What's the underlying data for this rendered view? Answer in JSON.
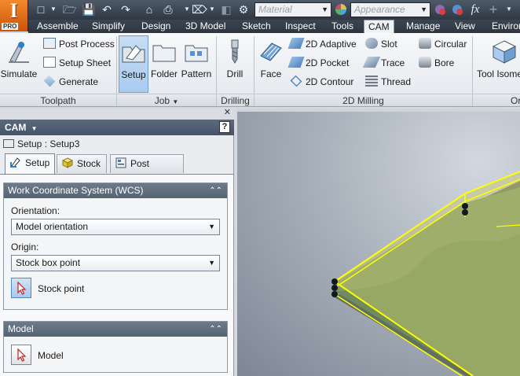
{
  "app": {
    "logo_letter": "I",
    "edition": "PRO"
  },
  "quick_access": {
    "material_placeholder": "Material",
    "appearance_placeholder": "Appearance",
    "fx_label": "fx"
  },
  "ribbon_tabs": [
    {
      "label": "Assemble"
    },
    {
      "label": "Simplify"
    },
    {
      "label": "Design"
    },
    {
      "label": "3D Model"
    },
    {
      "label": "Sketch"
    },
    {
      "label": "Inspect"
    },
    {
      "label": "Tools"
    },
    {
      "label": "CAM",
      "active": true
    },
    {
      "label": "Manage"
    },
    {
      "label": "View"
    },
    {
      "label": "Environ"
    }
  ],
  "ribbon": {
    "toolpath": {
      "label": "Toolpath",
      "simulate": "Simulate",
      "post_process": "Post Process",
      "setup_sheet": "Setup Sheet",
      "generate": "Generate"
    },
    "job": {
      "label": "Job",
      "setup": "Setup",
      "folder": "Folder",
      "pattern": "Pattern"
    },
    "drilling": {
      "label": "Drilling",
      "drill": "Drill"
    },
    "milling2d": {
      "label": "2D Milling",
      "face": "Face",
      "adaptive": "2D Adaptive",
      "pocket": "2D Pocket",
      "contour": "2D Contour",
      "slot": "Slot",
      "trace": "Trace",
      "thread": "Thread",
      "circular": "Circular",
      "bore": "Bore"
    },
    "next": {
      "tool_label": "Tool Isome",
      "group_label": "Or"
    }
  },
  "panel": {
    "title": "CAM",
    "breadcrumb": "Setup : Setup3",
    "tabs": [
      {
        "label": "Setup",
        "active": true
      },
      {
        "label": "Stock"
      },
      {
        "label": "Post Process"
      }
    ],
    "wcs": {
      "heading": "Work Coordinate System (WCS)",
      "orientation_label": "Orientation:",
      "orientation_value": "Model orientation",
      "origin_label": "Origin:",
      "origin_value": "Stock box point",
      "stock_point_label": "Stock point"
    },
    "model": {
      "heading": "Model",
      "model_label": "Model"
    }
  },
  "colors": {
    "accent": "#f07b1c",
    "selection": "#ffff00",
    "part_face": "#7e9a6c",
    "stock": "#b9ba5e"
  }
}
